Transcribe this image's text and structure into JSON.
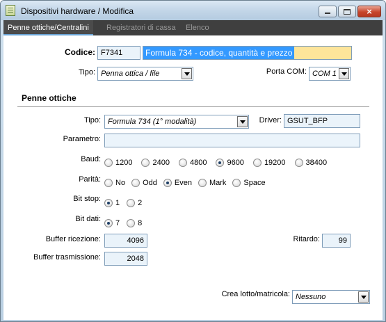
{
  "window": {
    "title": "Dispositivi hardware / Modifica",
    "icons": {
      "app": "app-document-icon",
      "minimize": "minimize-icon",
      "maximize": "maximize-icon",
      "close": "close-icon"
    }
  },
  "tabs": [
    {
      "label": "Penne ottiche/Centralini",
      "active": true
    },
    {
      "label": "Registratori di cassa",
      "active": false
    },
    {
      "label": "Elenco",
      "active": false
    }
  ],
  "header": {
    "codice_label": "Codice:",
    "codice_value": "F7341",
    "descrizione_value": "Formula 734 - codice, quantità e prezzo",
    "tipo_label": "Tipo:",
    "tipo_value": "Penna ottica / file",
    "porta_label": "Porta COM:",
    "porta_value": "COM 1"
  },
  "penne": {
    "section_title": "Penne ottiche",
    "tipo_label": "Tipo:",
    "tipo_value": "Formula 734 (1° modalità)",
    "driver_label": "Driver:",
    "driver_value": "GSUT_BFP",
    "parametro_label": "Parametro:",
    "parametro_value": "",
    "baud_label": "Baud:",
    "baud_options": [
      "1200",
      "2400",
      "4800",
      "9600",
      "19200",
      "38400"
    ],
    "baud_selected": "9600",
    "parita_label": "Parità:",
    "parita_options": [
      "No",
      "Odd",
      "Even",
      "Mark",
      "Space"
    ],
    "parita_selected": "Even",
    "bitstop_label": "Bit stop:",
    "bitstop_options": [
      "1",
      "2"
    ],
    "bitstop_selected": "1",
    "bitdati_label": "Bit dati:",
    "bitdati_options": [
      "7",
      "8"
    ],
    "bitdati_selected": "7",
    "buffer_ricezione_label": "Buffer ricezione:",
    "buffer_ricezione_value": "4096",
    "ritardo_label": "Ritardo:",
    "ritardo_value": "99",
    "buffer_trasmissione_label": "Buffer trasmissione:",
    "buffer_trasmissione_value": "2048",
    "crea_lotto_label": "Crea lotto/matricola:",
    "crea_lotto_value": "Nessuno"
  },
  "colors": {
    "accent": "#3399ff",
    "highlight_field": "#fde59a",
    "tab_bar": "#3f3f3f"
  }
}
